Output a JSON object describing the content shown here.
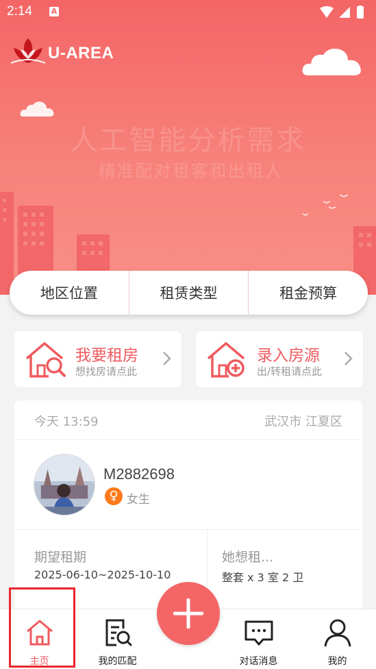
{
  "status_bar": {
    "time": "2:14",
    "notification_letter": "A"
  },
  "brand": {
    "name": "U-AREA"
  },
  "hero": {
    "title": "人工智能分析需求",
    "subtitle": "精准配对租客和出租人"
  },
  "filters": [
    {
      "label": "地区位置"
    },
    {
      "label": "租赁类型"
    },
    {
      "label": "租金预算"
    }
  ],
  "actions": [
    {
      "title": "我要租房",
      "subtitle": "想找房请点此",
      "icon": "house-search-icon"
    },
    {
      "title": "录入房源",
      "subtitle": "出/转租请点此",
      "icon": "house-add-icon"
    }
  ],
  "post": {
    "date": "今天 13:59",
    "location": "武汉市 江夏区",
    "username": "M2882698",
    "gender_symbol": "♀",
    "gender": "女生",
    "fields": [
      {
        "label": "期望租期",
        "value": "2025-06-10~2025-10-10"
      },
      {
        "label": "她想租...",
        "value": "整套 x 3 室 2 卫"
      }
    ]
  },
  "nav": [
    {
      "label": "主页",
      "icon": "home-icon",
      "active": true
    },
    {
      "label": "我的匹配",
      "icon": "match-document-icon",
      "active": false
    },
    {
      "label": "对话消息",
      "icon": "chat-icon",
      "active": false
    },
    {
      "label": "我的",
      "icon": "profile-icon",
      "active": false
    }
  ],
  "colors": {
    "accent": "#ef5a5f",
    "hero": "#f46566",
    "gender": "#ff7a1a"
  }
}
